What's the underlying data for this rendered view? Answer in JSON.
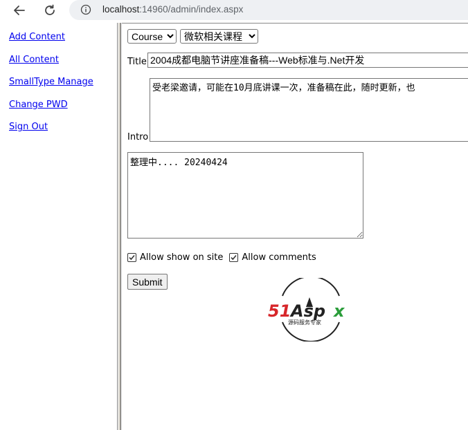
{
  "browser": {
    "url_host": "localhost",
    "url_rest": ":14960/admin/index.aspx"
  },
  "sidebar": {
    "items": [
      {
        "label": "Add Content"
      },
      {
        "label": "All Content"
      },
      {
        "label": "SmallType Manage"
      },
      {
        "label": "Change PWD"
      },
      {
        "label": "Sign Out"
      }
    ]
  },
  "form": {
    "category_select": "Course",
    "subcategory_select": "微软相关课程",
    "title_label": "Title",
    "title_value": "2004成都电脑节讲座准备稿---Web标准与.Net开发",
    "intro_label": "Intro",
    "intro_value": "受老梁邀请，可能在10月底讲课一次，准备稿在此，随时更新，也",
    "content_value": "整理中.... 20240424",
    "allow_show_label": "Allow show on site",
    "allow_show_checked": true,
    "allow_comments_label": "Allow comments",
    "allow_comments_checked": true,
    "submit_label": "Submit"
  },
  "logo": {
    "text": "51Aspx",
    "subtitle": "源码服务专家",
    "colors": {
      "red": "#d7262a",
      "green": "#2a9d3a",
      "dark": "#222222"
    }
  }
}
